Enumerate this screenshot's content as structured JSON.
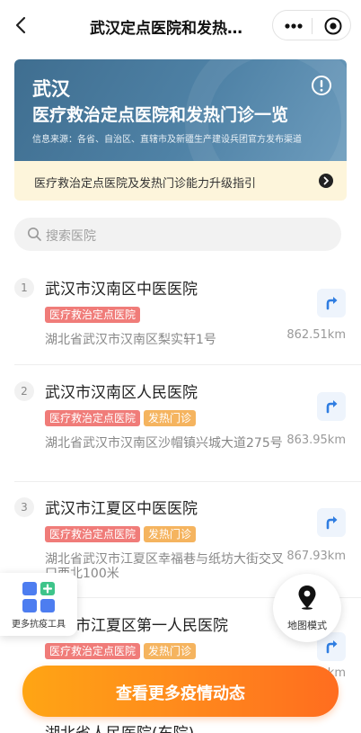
{
  "header": {
    "title": "武汉定点医院和发热…",
    "icons": {
      "back": "back-arrow-icon",
      "more": "more-dots-icon",
      "close": "target-close-icon"
    }
  },
  "banner": {
    "city": "武汉",
    "headline": "医疗救治定点医院和发热门诊一览",
    "source": "信息来源：各省、自治区、直辖市及新疆生产建设兵团官方发布渠道",
    "color": "#4a7a9e"
  },
  "guide": {
    "label": "医疗救治定点医院及发热门诊能力升级指引"
  },
  "search": {
    "placeholder": "搜索医院"
  },
  "hospitals": [
    {
      "index": "1",
      "name": "武汉市汉南区中医医院",
      "tags": [
        "医疗救治定点医院"
      ],
      "address": "湖北省武汉市汉南区梨实轩1号",
      "distance": "862.51km"
    },
    {
      "index": "2",
      "name": "武汉市汉南区人民医院",
      "tags": [
        "医疗救治定点医院",
        "发热门诊"
      ],
      "address": "湖北省武汉市汉南区沙帽镇兴城大道275号",
      "distance": "863.95km"
    },
    {
      "index": "3",
      "name": "武汉市江夏区中医医院",
      "tags": [
        "医疗救治定点医院",
        "发热门诊"
      ],
      "address": "湖北省武汉市江夏区幸福巷与纸坊大街交叉口西北100米",
      "distance": "867.93km"
    },
    {
      "index": "4",
      "name": "武汉市江夏区第一人民医院",
      "tags": [
        "医疗救治定点医院",
        "发热门诊"
      ],
      "address": "",
      "distance": "km"
    }
  ],
  "peek_item": {
    "name": "湖北省人民医院(东院)"
  },
  "floating": {
    "tools_label": "更多抗疫工具",
    "map_label": "地图模式"
  },
  "cta": {
    "label": "查看更多疫情动态"
  },
  "colors": {
    "tag_red": "#f07c79",
    "tag_orange": "#f5b45f",
    "nav_blue": "#2f7de1",
    "cta_orange": "#ff8a1c"
  }
}
